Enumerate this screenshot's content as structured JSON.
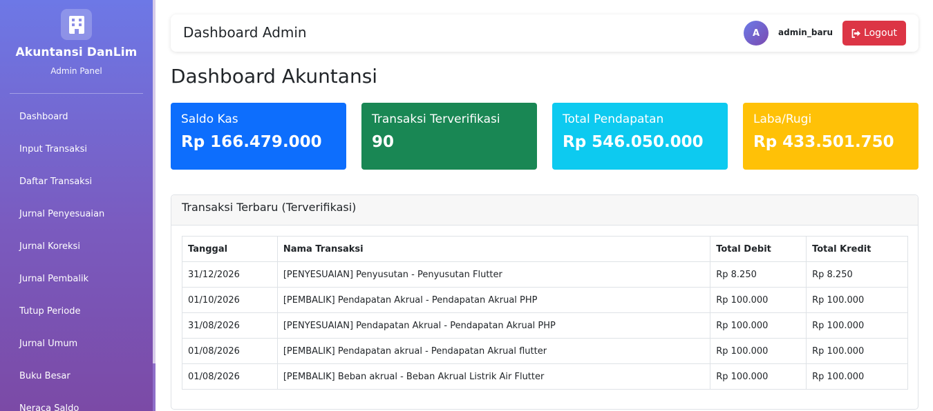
{
  "brand": {
    "title": "Akuntansi DanLim",
    "subtitle": "Admin Panel",
    "icon": "building-icon"
  },
  "sidebar": {
    "items": [
      {
        "label": "Dashboard"
      },
      {
        "label": "Input Transaksi"
      },
      {
        "label": "Daftar Transaksi"
      },
      {
        "label": "Jurnal Penyesuaian"
      },
      {
        "label": "Jurnal Koreksi"
      },
      {
        "label": "Jurnal Pembalik"
      },
      {
        "label": "Tutup Periode"
      },
      {
        "label": "Jurnal Umum"
      },
      {
        "label": "Buku Besar"
      },
      {
        "label": "Neraca Saldo"
      }
    ]
  },
  "header": {
    "title": "Dashboard Admin",
    "avatar_initial": "A",
    "username": "admin_baru",
    "logout_label": "Logout",
    "logout_icon": "sign-out-icon"
  },
  "page": {
    "title": "Dashboard Akuntansi"
  },
  "stats": [
    {
      "label": "Saldo Kas",
      "value": "Rp 166.479.000",
      "color": "#0d6efd"
    },
    {
      "label": "Transaksi Terverifikasi",
      "value": "90",
      "color": "#198754"
    },
    {
      "label": "Total Pendapatan",
      "value": "Rp 546.050.000",
      "color": "#0dcaf0"
    },
    {
      "label": "Laba/Rugi",
      "value": "Rp 433.501.750",
      "color": "#ffc107"
    }
  ],
  "recent": {
    "title": "Transaksi Terbaru (Terverifikasi)",
    "columns": [
      "Tanggal",
      "Nama Transaksi",
      "Total Debit",
      "Total Kredit"
    ],
    "rows": [
      {
        "date": "31/12/2026",
        "name": "[PENYESUAIAN] Penyusutan - Penyusutan Flutter",
        "debit": "Rp 8.250",
        "credit": "Rp 8.250"
      },
      {
        "date": "01/10/2026",
        "name": "[PEMBALIK] Pendapatan Akrual - Pendapatan Akrual PHP",
        "debit": "Rp 100.000",
        "credit": "Rp 100.000"
      },
      {
        "date": "31/08/2026",
        "name": "[PENYESUAIAN] Pendapatan Akrual - Pendapatan Akrual PHP",
        "debit": "Rp 100.000",
        "credit": "Rp 100.000"
      },
      {
        "date": "01/08/2026",
        "name": "[PEMBALIK] Pendapatan akrual - Pendapatan Akrual flutter",
        "debit": "Rp 100.000",
        "credit": "Rp 100.000"
      },
      {
        "date": "01/08/2026",
        "name": "[PEMBALIK] Beban akrual - Beban Akrual Listrik Air Flutter",
        "debit": "Rp 100.000",
        "credit": "Rp 100.000"
      }
    ]
  }
}
